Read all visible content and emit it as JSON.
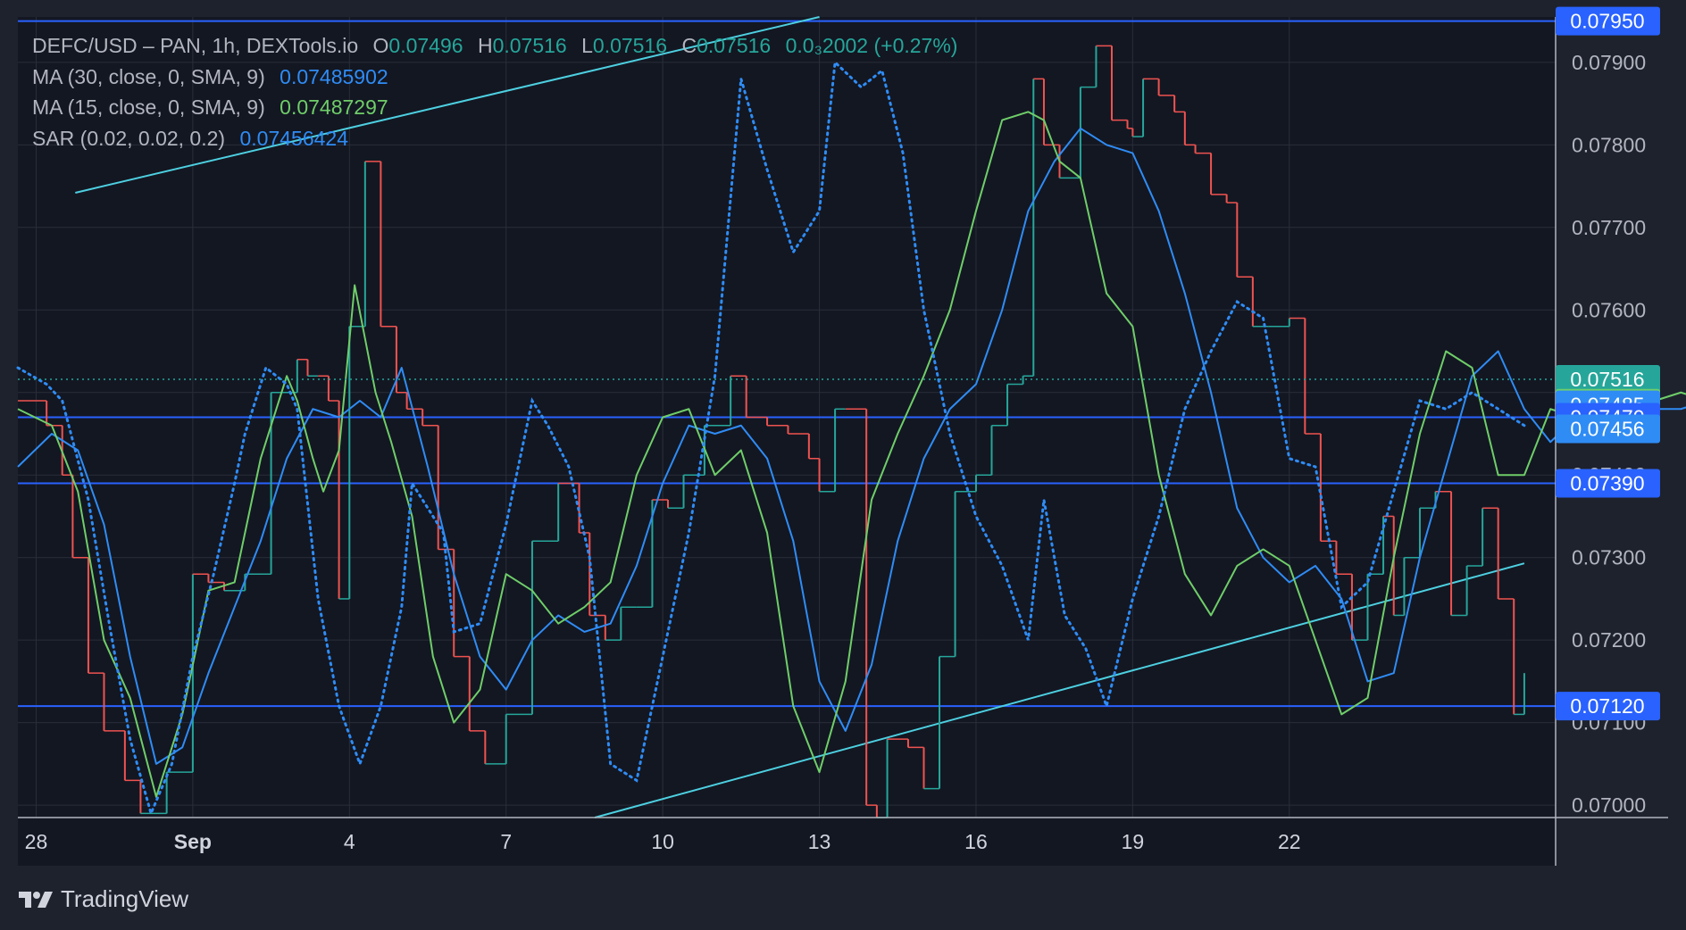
{
  "legend": {
    "symbol": "DEFC/USD – PAN, 1h, DEXTools.io",
    "o_label": "O",
    "o_value": "0.07496",
    "h_label": "H",
    "h_value": "0.07516",
    "l_label": "L",
    "l_value": "0.07516",
    "c_label": "C",
    "c_value": "0.07516",
    "change": "0.0₃2002 (+0.27%)",
    "ma30_label": "MA (30, close, 0, SMA, 9)",
    "ma30_value": "0.07485902",
    "ma15_label": "MA (15, close, 0, SMA, 9)",
    "ma15_value": "0.07487297",
    "sar_label": "SAR (0.02, 0.02, 0.2)",
    "sar_value": "0.07456424"
  },
  "brand": {
    "name": "TradingView",
    "icon": "tradingview-logo-icon"
  },
  "colors": {
    "background": "#1e222d",
    "plot_background": "#131722",
    "grid": "#2a2e39",
    "up": "#26a69a",
    "down": "#ef5350",
    "ma30": "#2f8cf5",
    "ma15": "#6fce69",
    "sar": "#2f8cf5",
    "hline": "#2962ff",
    "trendline": "#4dd0e1"
  },
  "chart_data": {
    "type": "line",
    "title": "DEFC/USD – PAN, 1h, DEXTools.io",
    "xlabel": "",
    "ylabel": "",
    "x_tick_labels": [
      "28",
      "Sep",
      "4",
      "7",
      "10",
      "13",
      "16",
      "19",
      "22"
    ],
    "y_tick_labels": [
      "0.07000",
      "0.07100",
      "0.07200",
      "0.07300",
      "0.07400",
      "0.07500",
      "0.07600",
      "0.07700",
      "0.07800",
      "0.07900"
    ],
    "ylim": [
      0.06985,
      0.07955
    ],
    "xlim_days": [
      -0.35,
      29.1
    ],
    "grid": true,
    "price_labels": [
      {
        "text": "0.07950",
        "value": 0.0795,
        "kind": "level"
      },
      {
        "text": "0.07516",
        "value": 0.07516,
        "kind": "last-price"
      },
      {
        "text": "0.07487",
        "value": 0.07487,
        "kind": "ma15"
      },
      {
        "text": "0.07485",
        "value": 0.07485,
        "kind": "ma30"
      },
      {
        "text": "0.07470",
        "value": 0.0747,
        "kind": "level"
      },
      {
        "text": "0.07456",
        "value": 0.07456,
        "kind": "sar"
      },
      {
        "text": "0.07390",
        "value": 0.0739,
        "kind": "level"
      },
      {
        "text": "0.07120",
        "value": 0.0712,
        "kind": "level"
      }
    ],
    "horizontal_levels": [
      0.0795,
      0.0747,
      0.0739,
      0.0712
    ],
    "last_price": 0.07516,
    "trendlines": [
      {
        "name": "upper",
        "p1": [
          0.75,
          0.07742
        ],
        "p2": [
          15,
          0.07955
        ]
      },
      {
        "name": "lower",
        "p1": [
          10.7,
          0.06985
        ],
        "p2": [
          28.5,
          0.07293
        ]
      }
    ],
    "series": [
      {
        "name": "Price (close)",
        "role": "candles",
        "x": [
          -0.35,
          0.2,
          0.5,
          0.7,
          1.0,
          1.3,
          1.7,
          2.0,
          2.5,
          3.0,
          3.3,
          3.6,
          4.0,
          4.5,
          5.0,
          5.2,
          5.4,
          5.6,
          5.8,
          6.0,
          6.3,
          6.6,
          6.9,
          7.1,
          7.4,
          7.7,
          8.0,
          8.3,
          8.6,
          9.0,
          9.5,
          10.0,
          10.4,
          10.6,
          10.9,
          11.2,
          11.5,
          11.8,
          12.1,
          12.4,
          12.8,
          13.3,
          13.6,
          14.0,
          14.4,
          14.8,
          15.0,
          15.3,
          15.5,
          15.9,
          16.1,
          16.3,
          16.7,
          17.0,
          17.3,
          17.6,
          18.0,
          18.3,
          18.6,
          18.9,
          19.1,
          19.3,
          19.6,
          20.0,
          20.3,
          20.6,
          20.9,
          21.0,
          21.2,
          21.5,
          21.8,
          22.0,
          22.2,
          22.5,
          22.8,
          23.0,
          23.3,
          23.6,
          24.0,
          24.3,
          24.6,
          24.9,
          25.2,
          25.5,
          25.8,
          26.0,
          26.2,
          26.5,
          26.8,
          27.1,
          27.4,
          27.7,
          28.0,
          28.3,
          28.5
        ],
        "values": [
          0.0749,
          0.0746,
          0.074,
          0.073,
          0.0716,
          0.0709,
          0.0703,
          0.0699,
          0.0704,
          0.0728,
          0.0727,
          0.0726,
          0.0728,
          0.075,
          0.0754,
          0.0752,
          0.0752,
          0.0749,
          0.0725,
          0.0758,
          0.0778,
          0.0758,
          0.075,
          0.0748,
          0.0746,
          0.0731,
          0.0718,
          0.0709,
          0.0705,
          0.0711,
          0.0732,
          0.0739,
          0.0733,
          0.0723,
          0.072,
          0.0724,
          0.0724,
          0.0737,
          0.0736,
          0.074,
          0.0746,
          0.0752,
          0.0747,
          0.0746,
          0.0745,
          0.0742,
          0.0738,
          0.0748,
          0.0748,
          0.07,
          0.0698,
          0.0708,
          0.0707,
          0.0702,
          0.0718,
          0.0738,
          0.074,
          0.0746,
          0.0751,
          0.0752,
          0.0788,
          0.078,
          0.0776,
          0.0787,
          0.0792,
          0.0783,
          0.0782,
          0.0781,
          0.0788,
          0.0786,
          0.0784,
          0.078,
          0.0779,
          0.0774,
          0.0773,
          0.0764,
          0.0758,
          0.0758,
          0.0759,
          0.0745,
          0.0732,
          0.0728,
          0.072,
          0.0728,
          0.0735,
          0.0723,
          0.073,
          0.0736,
          0.0738,
          0.0723,
          0.0729,
          0.0736,
          0.0725,
          0.0711,
          0.0716
        ]
      },
      {
        "name": "MA (30, close, 0, SMA, 9)",
        "x": [
          -0.35,
          0.3,
          0.8,
          1.3,
          1.8,
          2.3,
          2.8,
          3.3,
          3.8,
          4.3,
          4.8,
          5.3,
          5.8,
          6.2,
          6.6,
          7.0,
          7.5,
          8.0,
          8.5,
          9.0,
          9.5,
          10.0,
          10.5,
          11.0,
          11.5,
          12.0,
          12.5,
          13.0,
          13.5,
          14.0,
          14.5,
          15.0,
          15.5,
          16.0,
          16.5,
          17.0,
          17.5,
          18.0,
          18.5,
          19.0,
          19.5,
          20.0,
          20.5,
          21.0,
          21.5,
          22.0,
          22.5,
          23.0,
          23.5,
          24.0,
          24.5,
          25.0,
          25.5,
          26.0,
          26.5,
          27.0,
          27.5,
          28.0,
          28.5,
          29.0,
          29.5,
          30.0,
          30.5,
          31.0,
          31.5,
          32.0
        ],
        "values": [
          0.0741,
          0.0745,
          0.0743,
          0.0734,
          0.0718,
          0.0705,
          0.0707,
          0.0716,
          0.0724,
          0.0732,
          0.0742,
          0.0748,
          0.0747,
          0.0749,
          0.0747,
          0.0753,
          0.0741,
          0.0728,
          0.0718,
          0.0714,
          0.072,
          0.0723,
          0.0721,
          0.0722,
          0.0729,
          0.0739,
          0.0746,
          0.0745,
          0.0746,
          0.0742,
          0.0732,
          0.0715,
          0.0709,
          0.0717,
          0.0732,
          0.0742,
          0.0748,
          0.0751,
          0.076,
          0.0772,
          0.0778,
          0.0782,
          0.078,
          0.0779,
          0.0772,
          0.0762,
          0.075,
          0.0736,
          0.073,
          0.0727,
          0.0729,
          0.0725,
          0.0715,
          0.0716,
          0.073,
          0.0741,
          0.0752,
          0.0755,
          0.0748,
          0.0744,
          0.0747,
          0.0747,
          0.0748,
          0.0748,
          0.0748,
          0.0749
        ]
      },
      {
        "name": "MA (15, close, 0, SMA, 9)",
        "x": [
          -0.35,
          0.3,
          0.8,
          1.3,
          1.8,
          2.3,
          2.8,
          3.3,
          3.8,
          4.3,
          4.8,
          5.0,
          5.3,
          5.5,
          5.8,
          6.1,
          6.5,
          6.8,
          7.2,
          7.6,
          8.0,
          8.5,
          9.0,
          9.5,
          10.0,
          10.5,
          11.0,
          11.5,
          12.0,
          12.5,
          13.0,
          13.5,
          14.0,
          14.5,
          15.0,
          15.5,
          16.0,
          16.5,
          17.0,
          17.5,
          18.0,
          18.5,
          19.0,
          19.3,
          19.6,
          20.0,
          20.5,
          21.0,
          21.5,
          22.0,
          22.5,
          23.0,
          23.5,
          24.0,
          24.5,
          25.0,
          25.5,
          26.0,
          26.5,
          27.0,
          27.5,
          28.0,
          28.5,
          29.0,
          29.5,
          30.0,
          30.5,
          31.0,
          31.5,
          32.0
        ],
        "values": [
          0.0748,
          0.0746,
          0.0738,
          0.072,
          0.0713,
          0.0701,
          0.0711,
          0.0726,
          0.0727,
          0.0742,
          0.0752,
          0.0749,
          0.0742,
          0.0738,
          0.0743,
          0.0763,
          0.075,
          0.0744,
          0.0735,
          0.0718,
          0.071,
          0.0714,
          0.0728,
          0.0726,
          0.0722,
          0.0724,
          0.0727,
          0.074,
          0.0747,
          0.0748,
          0.074,
          0.0743,
          0.0733,
          0.0712,
          0.0704,
          0.0715,
          0.0737,
          0.0745,
          0.0752,
          0.076,
          0.0772,
          0.0783,
          0.0784,
          0.0783,
          0.0778,
          0.0776,
          0.0762,
          0.0758,
          0.074,
          0.0728,
          0.0723,
          0.0729,
          0.0731,
          0.0729,
          0.072,
          0.0711,
          0.0713,
          0.073,
          0.0745,
          0.0755,
          0.0753,
          0.074,
          0.074,
          0.0748,
          0.0747,
          0.0749,
          0.0748,
          0.0749,
          0.075,
          0.0749
        ]
      },
      {
        "name": "SAR (0.02, 0.02, 0.2)",
        "role": "dots",
        "x": [
          -0.35,
          0.2,
          0.5,
          1.0,
          1.4,
          1.8,
          2.2,
          2.6,
          3.0,
          3.4,
          3.8,
          4.0,
          4.4,
          4.8,
          5.0,
          5.4,
          5.8,
          6.2,
          6.6,
          7.0,
          7.2,
          7.8,
          8.0,
          8.5,
          9.0,
          9.5,
          9.8,
          10.2,
          10.6,
          11.0,
          11.5,
          12.0,
          12.5,
          13.0,
          13.5,
          14.0,
          14.5,
          15.0,
          15.3,
          15.8,
          16.2,
          16.6,
          17.0,
          17.5,
          18.0,
          18.5,
          19.0,
          19.3,
          19.7,
          20.1,
          20.5,
          21.0,
          21.5,
          22.0,
          22.5,
          23.0,
          23.5,
          24.0,
          24.5,
          25.0,
          25.5,
          26.0,
          26.5,
          27.0,
          27.5,
          28.0,
          28.5
        ],
        "values": [
          0.0753,
          0.0751,
          0.0749,
          0.0737,
          0.0722,
          0.0708,
          0.0699,
          0.0705,
          0.0718,
          0.0728,
          0.0739,
          0.0745,
          0.0753,
          0.0751,
          0.0748,
          0.0725,
          0.0712,
          0.0705,
          0.0712,
          0.0724,
          0.0739,
          0.0733,
          0.0721,
          0.0722,
          0.0734,
          0.0749,
          0.0746,
          0.0741,
          0.073,
          0.0705,
          0.0703,
          0.0718,
          0.0733,
          0.0752,
          0.0788,
          0.0777,
          0.0767,
          0.0772,
          0.079,
          0.0787,
          0.0789,
          0.0779,
          0.076,
          0.0745,
          0.0735,
          0.0729,
          0.072,
          0.0737,
          0.0723,
          0.0719,
          0.0712,
          0.0725,
          0.0735,
          0.0748,
          0.0755,
          0.0761,
          0.0759,
          0.0742,
          0.0741,
          0.0724,
          0.0727,
          0.0738,
          0.0749,
          0.0748,
          0.075,
          0.0748,
          0.0746
        ]
      }
    ]
  }
}
